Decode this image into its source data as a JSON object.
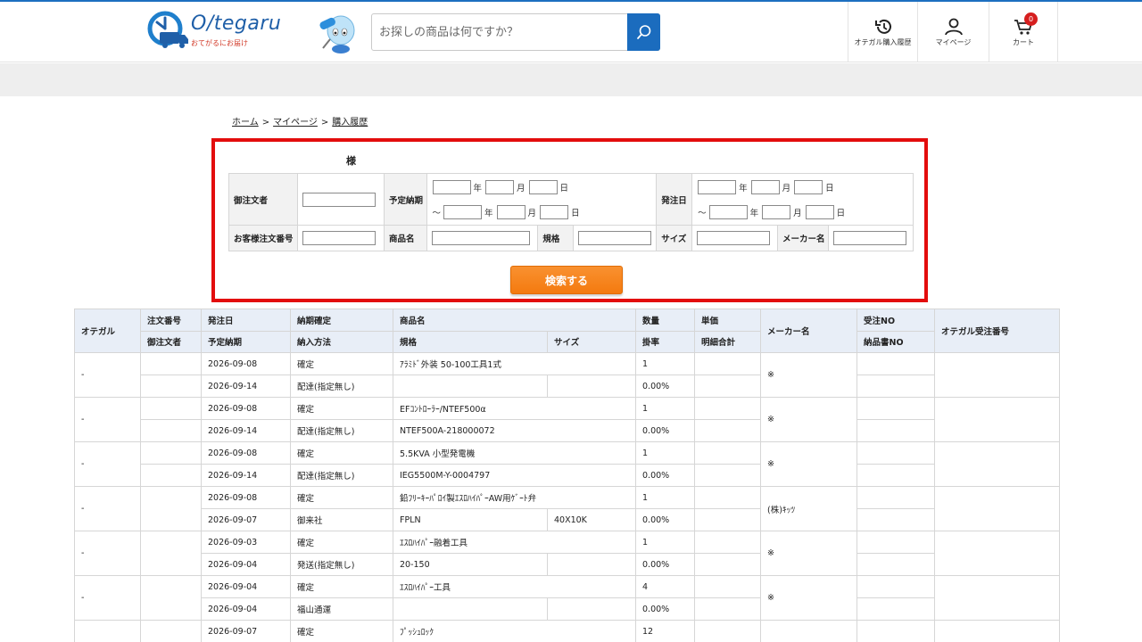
{
  "brand": {
    "name": "O/tegaru",
    "tagline": "おてがるにお届け",
    "accent": "#1d6fc0"
  },
  "search": {
    "placeholder": "お探しの商品は何ですか？"
  },
  "header_nav": {
    "history": "オテガル購入履歴",
    "mypage": "マイページ",
    "cart": "カート",
    "cart_count": "0"
  },
  "breadcrumb": {
    "home": "ホーム",
    "sep": ">",
    "mypage": "マイページ",
    "current": "購入履歴"
  },
  "form": {
    "honorific": "様",
    "orderer_label": "御注文者",
    "delivery_label": "予定納期",
    "order_date_label": "発注日",
    "customer_order_no_label": "お客様注文番号",
    "product_name_label": "商品名",
    "spec_label": "規格",
    "size_label": "サイズ",
    "maker_label": "メーカー名",
    "year": "年",
    "month": "月",
    "day": "日",
    "tilde": "～",
    "submit": "検索する"
  },
  "results": {
    "headers": {
      "otegaru": "オテガル",
      "order_no": "注文番号",
      "orderer": "御注文者",
      "order_date": "発注日",
      "delivery": "予定納期",
      "confirm": "納期確定",
      "method": "納入方法",
      "product": "商品名",
      "spec": "規格",
      "size": "サイズ",
      "qty": "数量",
      "rate": "掛率",
      "unit_price": "単価",
      "subtotal": "明細合計",
      "maker": "メーカー名",
      "receipt_no": "受注NO",
      "delivery_note_no": "納品書NO",
      "otegaru_receipt_no": "オテガル受注番号"
    },
    "rows": [
      {
        "otegaru": "-",
        "order_date": "2026-09-08",
        "confirm": "確定",
        "product": "ｱﾗﾐﾄﾞ外装 50-100工具1式",
        "qty": "1",
        "delivery": "2026-09-14",
        "method": "配達(指定無し)",
        "spec": "",
        "size": "",
        "rate": "0.00%",
        "maker": "※"
      },
      {
        "otegaru": "-",
        "order_date": "2026-09-08",
        "confirm": "確定",
        "product": "EFｺﾝﾄﾛｰﾗｰ/NTEF500α",
        "qty": "1",
        "delivery": "2026-09-14",
        "method": "配達(指定無し)",
        "spec": "NTEF500A-218000072",
        "size": "",
        "rate": "0.00%",
        "maker": "※"
      },
      {
        "otegaru": "-",
        "order_date": "2026-09-08",
        "confirm": "確定",
        "product": "5.5KVA 小型発電機",
        "qty": "1",
        "delivery": "2026-09-14",
        "method": "配達(指定無し)",
        "spec": "IEG5500M-Y-0004797",
        "size": "",
        "rate": "0.00%",
        "maker": "※"
      },
      {
        "otegaru": "-",
        "order_date": "2026-09-08",
        "confirm": "確定",
        "product": "鉛ﾌﾘｰｷｰﾊﾟﾛｲ製ｴｽﾛﾊｲﾊﾟｰAW用ｹﾞｰﾄ弁",
        "qty": "1",
        "delivery": "2026-09-07",
        "method": "御来社",
        "spec": "FPLN",
        "size": "40X10K",
        "rate": "0.00%",
        "maker": "(株)ｷｯﾂ"
      },
      {
        "otegaru": "-",
        "order_date": "2026-09-03",
        "confirm": "確定",
        "product": "ｴｽﾛﾊｲﾊﾟｰ融着工具",
        "qty": "1",
        "delivery": "2026-09-04",
        "method": "発送(指定無し)",
        "spec": "20-150",
        "size": "",
        "rate": "0.00%",
        "maker": "※"
      },
      {
        "otegaru": "-",
        "order_date": "2026-09-04",
        "confirm": "確定",
        "product": "ｴｽﾛﾊｲﾊﾟｰ工具",
        "qty": "4",
        "delivery": "2026-09-04",
        "method": "福山通運",
        "spec": "",
        "size": "",
        "rate": "0.00%",
        "maker": "※"
      },
      {
        "otegaru": "",
        "order_date": "2026-09-07",
        "confirm": "確定",
        "product": "ﾌﾟｯｼｭﾛｯｸ",
        "qty": "12",
        "delivery": "",
        "method": "",
        "spec": "",
        "size": "",
        "rate": "",
        "maker": ""
      }
    ]
  }
}
